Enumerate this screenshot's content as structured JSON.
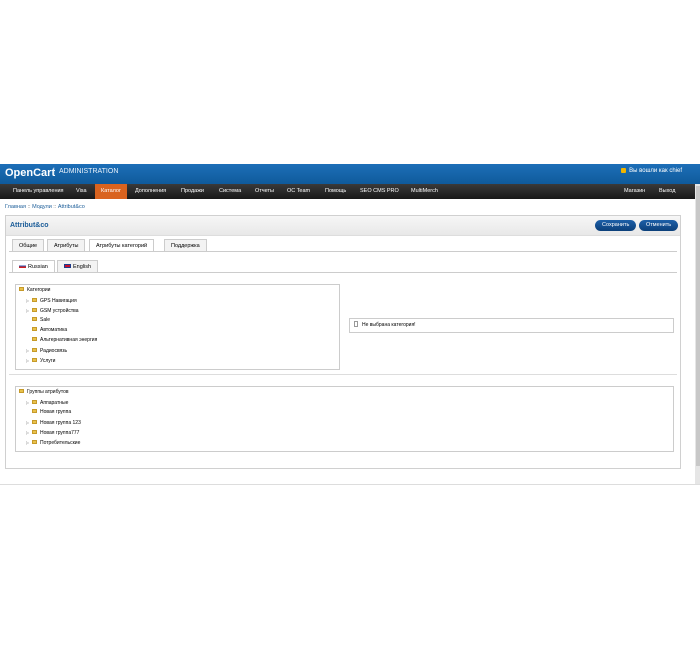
{
  "header": {
    "brand": "OpenCart",
    "separator": "|",
    "subtitle": "ADMINISTRATION",
    "login_text": "Вы вошли как chief"
  },
  "menu": {
    "items": [
      "Панель управления",
      "Visa",
      "Каталог",
      "Дополнения",
      "Продажи",
      "Система",
      "Отчеты",
      "OC Team",
      "Помощь",
      "SEO CMS PRO",
      "MultiMerch"
    ],
    "active": "Каталог",
    "right_items": [
      "Магазин",
      "Выход"
    ]
  },
  "breadcrumb": [
    "Главная",
    "Модули",
    "Attribut&co"
  ],
  "breadcrumb_sep": "::",
  "page": {
    "title": "Attribut&co",
    "save_label": "Сохранить",
    "cancel_label": "Отменить"
  },
  "tabs": [
    "Общие",
    "Атрибуты",
    "Атрибуты категорий",
    "Поддержка"
  ],
  "active_tab": "Атрибуты категорий",
  "lang_tabs": [
    "Russian",
    "English"
  ],
  "category_tree": {
    "root": "Категории",
    "children": [
      "GPS Навигация",
      "GSM устройства",
      "Sale",
      "Автоматика",
      "Альтернативная энергия",
      "Радиосвязь",
      "Услуги"
    ]
  },
  "no_category_text": "Не выбрана категория!",
  "attribute_tree": {
    "root": "Группы атрибутов",
    "children": [
      "Аппаратные",
      "Новая группа",
      "Новая группа 123",
      "Новая группа777",
      "Потребительские"
    ]
  },
  "colors": {
    "header": "#1d6fb8",
    "menubar": "#222222",
    "menu_active": "#d9631f",
    "button": "#0b3f7a",
    "link": "#1a5c98"
  }
}
